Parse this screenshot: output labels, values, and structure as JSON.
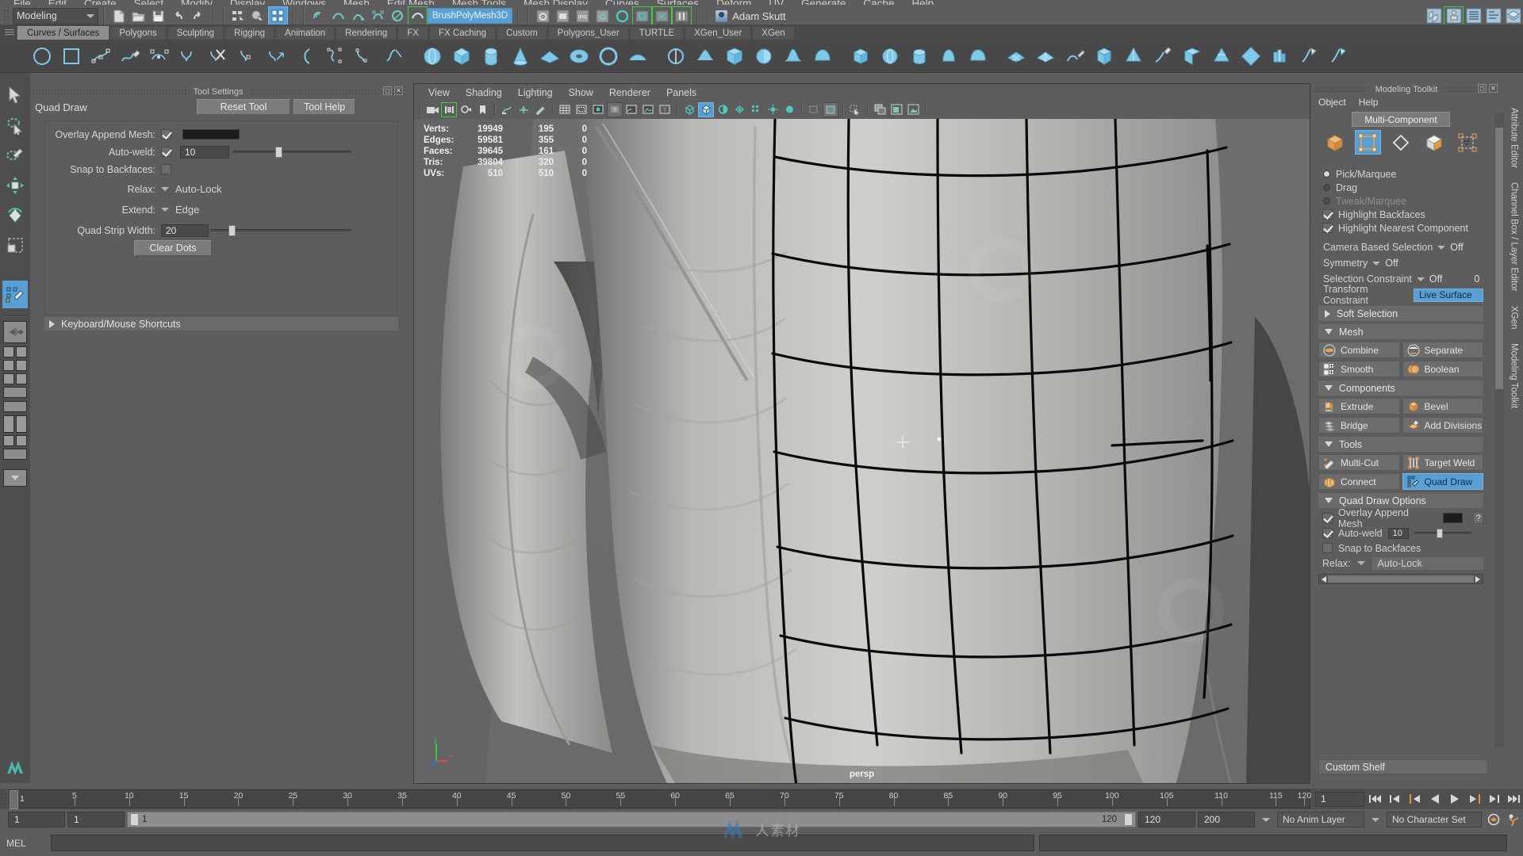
{
  "menu_bar": {
    "items": [
      "File",
      "Edit",
      "Create",
      "Select",
      "Modify",
      "Display",
      "Windows",
      "Mesh",
      "Edit Mesh",
      "Mesh Tools",
      "Mesh Display",
      "Curves",
      "Surfaces",
      "Deform",
      "UV",
      "Generate",
      "Cache",
      "Help"
    ]
  },
  "status_line": {
    "menu_set": "Modeling",
    "brush_field": "BrushPolyMesh3D",
    "user": "Adam Skutt"
  },
  "shelf": {
    "tabs": [
      "Curves / Surfaces",
      "Polygons",
      "Sculpting",
      "Rigging",
      "Animation",
      "Rendering",
      "FX",
      "FX Caching",
      "Custom",
      "Polygons_User",
      "TURTLE",
      "XGen_User",
      "XGen"
    ],
    "active_tab": "Curves / Surfaces"
  },
  "tool_settings": {
    "panel_title": "Tool Settings",
    "tool_name": "Quad Draw",
    "reset_label": "Reset Tool",
    "help_label": "Tool Help",
    "rows": {
      "overlay_append_mesh_label": "Overlay Append Mesh:",
      "overlay_append_mesh_checked": true,
      "overlay_color": "#1c1c1c",
      "auto_weld_label": "Auto-weld:",
      "auto_weld_checked": true,
      "auto_weld_value": "10",
      "snap_backfaces_label": "Snap to Backfaces:",
      "snap_backfaces_checked": false,
      "relax_label": "Relax:",
      "relax_value": "Auto-Lock",
      "extend_label": "Extend:",
      "extend_value": "Edge",
      "quad_strip_label": "Quad Strip Width:",
      "quad_strip_value": "20",
      "clear_dots_label": "Clear Dots"
    },
    "shortcuts_label": "Keyboard/Mouse Shortcuts"
  },
  "viewport": {
    "menus": [
      "View",
      "Shading",
      "Lighting",
      "Show",
      "Renderer",
      "Panels"
    ],
    "camera_label": "persp",
    "hud": {
      "rows": [
        {
          "label": "Verts:",
          "total": "19949",
          "selected": "195",
          "third": "0"
        },
        {
          "label": "Edges:",
          "total": "59581",
          "selected": "355",
          "third": "0"
        },
        {
          "label": "Faces:",
          "total": "39645",
          "selected": "161",
          "third": "0"
        },
        {
          "label": "Tris:",
          "total": "39804",
          "selected": "320",
          "third": "0"
        },
        {
          "label": "UVs:",
          "total": "510",
          "selected": "510",
          "third": "0"
        }
      ]
    },
    "axes": {
      "x": "x",
      "y": "y",
      "z": "z"
    }
  },
  "modeling_toolkit": {
    "panel_title": "Modeling Toolkit",
    "menus": [
      "Object",
      "Help"
    ],
    "multi_component_label": "Multi-Component",
    "component_icons": [
      "object-mode-icon",
      "multi-component-icon",
      "face-mode-icon",
      "vertex-mode-icon",
      "uv-mode-icon"
    ],
    "selection_modes": [
      {
        "label": "Pick/Marquee",
        "selected": true,
        "disabled": false
      },
      {
        "label": "Drag",
        "selected": false,
        "disabled": false
      },
      {
        "label": "Tweak/Marquee",
        "selected": false,
        "disabled": true
      }
    ],
    "checkboxes": [
      {
        "label": "Highlight Backfaces",
        "checked": true
      },
      {
        "label": "Highlight Nearest Component",
        "checked": true
      }
    ],
    "dropdowns": [
      {
        "label": "Camera Based Selection",
        "value": "Off"
      },
      {
        "label": "Symmetry",
        "value": "Off"
      },
      {
        "label": "Selection Constraint",
        "value": "Off",
        "extra": "0"
      }
    ],
    "transform_constraint_label": "Transform Constraint",
    "live_surface_label": "Live Surface",
    "soft_selection_label": "Soft Selection",
    "sections": [
      {
        "title": "Mesh",
        "buttons": [
          {
            "label": "Combine",
            "icon": "combine-icon"
          },
          {
            "label": "Separate",
            "icon": "separate-icon"
          },
          {
            "label": "Smooth",
            "icon": "smooth-icon"
          },
          {
            "label": "Boolean",
            "icon": "boolean-icon"
          }
        ]
      },
      {
        "title": "Components",
        "buttons": [
          {
            "label": "Extrude",
            "icon": "extrude-icon"
          },
          {
            "label": "Bevel",
            "icon": "bevel-icon"
          },
          {
            "label": "Bridge",
            "icon": "bridge-icon"
          },
          {
            "label": "Add Divisions",
            "icon": "add-divisions-icon"
          }
        ]
      },
      {
        "title": "Tools",
        "buttons": [
          {
            "label": "Multi-Cut",
            "icon": "multi-cut-icon",
            "active": false
          },
          {
            "label": "Target Weld",
            "icon": "target-weld-icon",
            "active": false
          },
          {
            "label": "Connect",
            "icon": "connect-icon",
            "active": false
          },
          {
            "label": "Quad Draw",
            "icon": "quad-draw-icon",
            "active": true
          }
        ]
      }
    ],
    "quad_draw_options": {
      "title": "Quad Draw Options",
      "overlay_label": "Overlay Append Mesh",
      "overlay_checked": true,
      "overlay_color": "#1c1c1c",
      "auto_weld_label": "Auto-weld",
      "auto_weld_checked": true,
      "auto_weld_value": "10",
      "snap_label": "Snap to Backfaces",
      "snap_checked": false,
      "relax_label": "Relax:",
      "relax_value": "Auto-Lock",
      "help_glyph": "?"
    },
    "custom_shelf_label": "Custom Shelf"
  },
  "side_tabs": [
    "Attribute Editor",
    "Channel Box / Layer Editor",
    "XGen",
    "Modeling Toolkit"
  ],
  "time_slider": {
    "current_frame": "1",
    "ticks": [
      5,
      10,
      15,
      20,
      25,
      30,
      35,
      40,
      45,
      50,
      55,
      60,
      65,
      70,
      75,
      80,
      85,
      90,
      95,
      100,
      105,
      110,
      115,
      120
    ],
    "start": 1,
    "end": 120,
    "cursor_label": "1",
    "playback_buttons": [
      "go-to-start-icon",
      "step-back-keyframe-icon",
      "step-back-frame-icon",
      "play-backwards-icon",
      "play-forwards-icon",
      "step-forward-frame-icon",
      "step-forward-keyframe-icon",
      "go-to-end-icon"
    ]
  },
  "range_slider": {
    "anim_start": "1",
    "range_start": "1",
    "range_handle_label": "1",
    "range_end_label": "120",
    "range_end": "120",
    "anim_end": "200",
    "anim_layer": "No Anim Layer",
    "character_set": "No Character Set"
  },
  "command_line": {
    "label": "MEL",
    "input_value": "",
    "result_value": ""
  },
  "watermark": {
    "text": "人素材"
  },
  "colors": {
    "accent_blue": "#5a9fd4",
    "panel_bg": "#5d5d5d",
    "dark_field": "#4a4a4a",
    "shelf_bg": "#484848",
    "section_bg": "#6a6a6a",
    "orange": "#e2913f"
  }
}
